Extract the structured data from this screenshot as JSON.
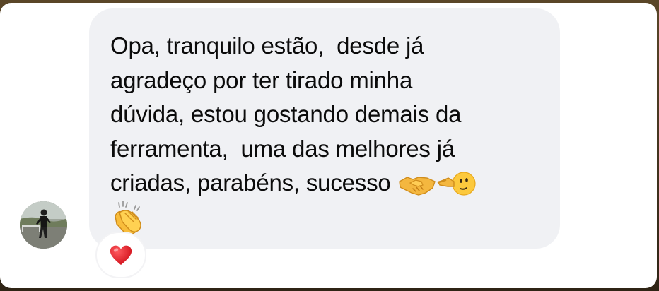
{
  "message": {
    "lines": [
      "Opa, tranquilo estão,  desde já",
      "agradeço por ter tirado minha",
      "dúvida, estou gostando demais da",
      "ferramenta,  uma das melhores já",
      "criadas, parabéns, sucesso"
    ],
    "emojis": [
      "handshake-emoji",
      "pointing-face-emoji",
      "clapping-hands-emoji"
    ]
  },
  "reaction": {
    "icon": "red-heart-icon"
  },
  "colors": {
    "bubble": "#f0f1f4",
    "text": "#0b0b0b",
    "heart": "#e0202a",
    "card": "#ffffff"
  }
}
